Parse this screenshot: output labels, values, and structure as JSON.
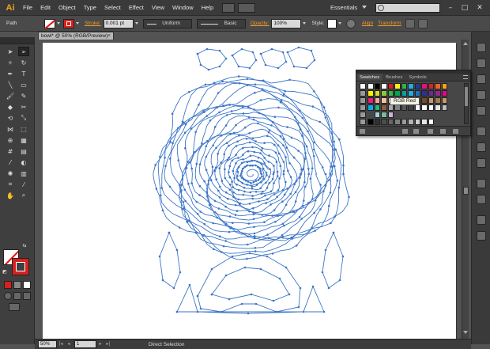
{
  "app": {
    "logo_text": "Ai"
  },
  "menu": [
    "File",
    "Edit",
    "Object",
    "Type",
    "Select",
    "Effect",
    "View",
    "Window",
    "Help"
  ],
  "workspace": {
    "label": "Essentials"
  },
  "controlbar": {
    "selection": "Path",
    "stroke_label": "Stroke:",
    "stroke_weight": "0.001 pt",
    "profile": "Uniform",
    "brush": "Basic",
    "opacity_label": "Opacity:",
    "opacity_value": "100%",
    "style_label": "Style:",
    "align_label": "Align",
    "transform_label": "Transform"
  },
  "document": {
    "tab_title": "bowl* @ 50% (RGB/Preview)"
  },
  "swatches": {
    "tabs": [
      "Swatches",
      "Brushes",
      "Symbols"
    ],
    "tooltip": "RGB Red"
  },
  "status": {
    "zoom": "50%",
    "page": "1",
    "tool": "Direct Selection"
  },
  "colors": {
    "accent": "#f29b2b",
    "path_blue": "#3d76c7",
    "stroke_red": "#d9201f",
    "artboard": "#ffffff",
    "ui_bg": "#535353"
  }
}
